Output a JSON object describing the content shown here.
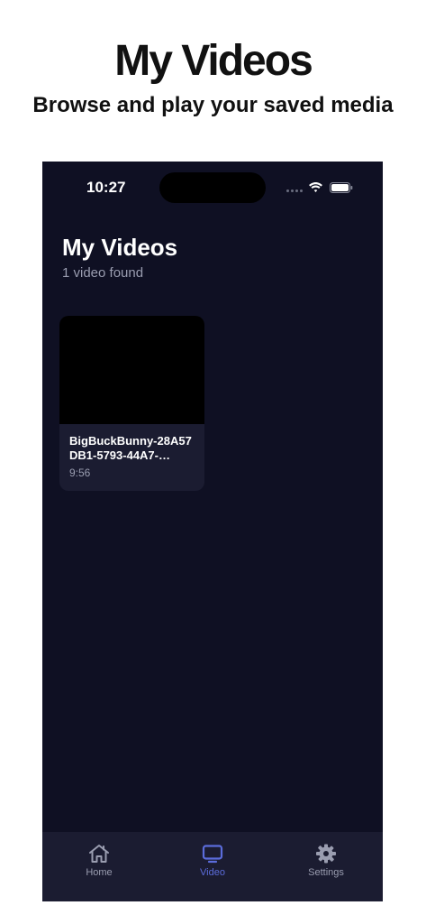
{
  "promo": {
    "title": "My Videos",
    "subtitle": "Browse and play your saved media"
  },
  "status_bar": {
    "time": "10:27",
    "icons": [
      "signal-dots-icon",
      "wifi-icon",
      "battery-icon"
    ]
  },
  "screen": {
    "title": "My Videos",
    "subtitle": "1 video found"
  },
  "videos": [
    {
      "name": "BigBuckBunny-28A57DB1-5793-44A7-…",
      "duration": "9:56"
    }
  ],
  "tab_bar": {
    "tabs": [
      {
        "label": "Home",
        "icon": "home-icon",
        "active": false
      },
      {
        "label": "Video",
        "icon": "tv-icon",
        "active": true
      },
      {
        "label": "Settings",
        "icon": "gear-icon",
        "active": false
      }
    ]
  },
  "colors": {
    "background": "#0f1023",
    "card": "#1b1c31",
    "accent": "#5b6cdb",
    "muted_text": "#9a9db0"
  }
}
